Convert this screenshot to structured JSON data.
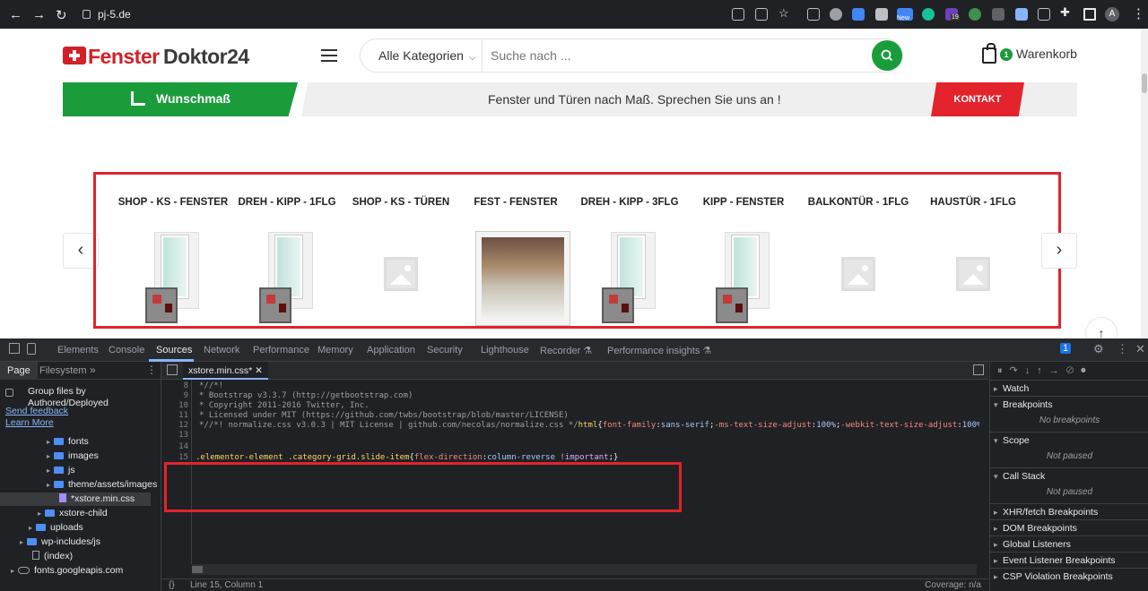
{
  "browser": {
    "url": "pj-5.de",
    "avatar_letter": "A",
    "badge_count": "19",
    "new_badge": "New"
  },
  "site": {
    "logo_part1": "Fenster",
    "logo_part2": "Doktor24",
    "category_select": "Alle Kategorien",
    "search_placeholder": "Suche nach ...",
    "cart_count": "1",
    "cart_label": "Warenkorb",
    "wunsch_label": "Wunschmaß",
    "banner_message": "Fenster und Türen nach Maß. Sprechen Sie uns an !",
    "kontakt_label": "KONTAKT",
    "categories": [
      {
        "name": "SHOP - KS - FENSTER",
        "image": "window-profile"
      },
      {
        "name": "DREH - KIPP - 1FLG",
        "image": "window-profile"
      },
      {
        "name": "SHOP - KS - TÜREN",
        "image": "placeholder"
      },
      {
        "name": "FEST - FENSTER",
        "image": "photo"
      },
      {
        "name": "DREH - KIPP - 3FLG",
        "image": "window-profile"
      },
      {
        "name": "KIPP - FENSTER",
        "image": "window-profile"
      },
      {
        "name": "BALKONTÜR - 1FLG",
        "image": "placeholder"
      },
      {
        "name": "HAUSTÜR - 1FLG",
        "image": "placeholder"
      }
    ]
  },
  "devtools": {
    "tabs": [
      "Elements",
      "Console",
      "Sources",
      "Network",
      "Performance",
      "Memory",
      "Application",
      "Security",
      "Lighthouse",
      "Recorder ⚗",
      "Performance insights ⚗"
    ],
    "active_tab": "Sources",
    "issues_count": "1",
    "left_tabs": [
      "Page",
      "Filesystem"
    ],
    "group_files_label": "Group files by Authored/Deployed",
    "send_feedback": "Send feedback",
    "learn_more": "Learn More",
    "tree": [
      {
        "label": "fonts",
        "type": "folder"
      },
      {
        "label": "images",
        "type": "folder"
      },
      {
        "label": "js",
        "type": "folder"
      },
      {
        "label": "theme/assets/images",
        "type": "folder"
      },
      {
        "label": "*xstore.min.css",
        "type": "file"
      },
      {
        "label": "xstore-child",
        "type": "folder"
      },
      {
        "label": "uploads",
        "type": "folder"
      },
      {
        "label": "wp-includes/js",
        "type": "folder"
      },
      {
        "label": "(index)",
        "type": "page"
      },
      {
        "label": "fonts.googleapis.com",
        "type": "cloud"
      }
    ],
    "editor_tab": "xstore.min.css*",
    "code_lines": [
      {
        "n": "8",
        "text": "*//*!"
      },
      {
        "n": "9",
        "text": " * Bootstrap v3.3.7 (http://getbootstrap.com)"
      },
      {
        "n": "10",
        "text": " * Copyright 2011-2016 Twitter, Inc."
      },
      {
        "n": "11",
        "text": " * Licensed under MIT (https://github.com/twbs/bootstrap/blob/master/LICENSE)"
      },
      {
        "n": "12",
        "text": " *//*! normalize.css v3.0.3 | MIT License | github.com/necolas/normalize.css */"
      },
      {
        "n": "13",
        "text": ""
      },
      {
        "n": "14",
        "text": ""
      },
      {
        "n": "15",
        "text": ""
      }
    ],
    "line12_css": {
      "sel": "html",
      "p1": "font-family",
      "v1": "sans-serif",
      "p2": "-ms-text-size-adjust",
      "v2": "100%",
      "p3": "-webkit-text-size-adjust",
      "v3": "100%"
    },
    "line15_css": {
      "sel": ".elementor-element .category-grid.slide-item",
      "prop": "flex-direction",
      "val": "column-reverse",
      "imp": "!important"
    },
    "status_left": "Line 15, Column 1",
    "status_right": "Coverage: n/a",
    "right_panels": [
      "Watch",
      "Breakpoints",
      "Scope",
      "Call Stack",
      "XHR/fetch Breakpoints",
      "DOM Breakpoints",
      "Global Listeners",
      "Event Listener Breakpoints",
      "CSP Violation Breakpoints"
    ],
    "no_breakpoints": "No breakpoints",
    "not_paused": "Not paused"
  },
  "colors": {
    "brand_green": "#1a9c3b",
    "brand_red": "#d32027",
    "highlight_red": "#e3232c"
  }
}
